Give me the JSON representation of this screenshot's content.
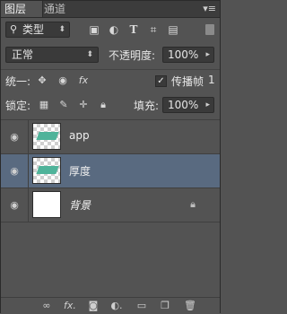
{
  "tabs": [
    {
      "label": "图层"
    },
    {
      "label": "通道"
    }
  ],
  "menu_icon": "panel-menu-icon",
  "filter": {
    "kind_label": "类型",
    "icons": [
      "image-filter-icon",
      "adjustment-filter-icon",
      "type-filter-icon",
      "shape-filter-icon",
      "smart-object-filter-icon"
    ]
  },
  "blend": {
    "mode": "正常",
    "opacity_label": "不透明度:",
    "opacity_value": "100%"
  },
  "unify": {
    "label": "统一:",
    "propagate_label": "传播帧",
    "propagate_checked": true,
    "frame_number": "1"
  },
  "lock": {
    "label": "锁定:",
    "fill_label": "填充:",
    "fill_value": "100%"
  },
  "layers": [
    {
      "name": "app",
      "visible": true,
      "selected": false,
      "thumbnail": "transparent-shape",
      "locked": false
    },
    {
      "name": "厚度",
      "visible": true,
      "selected": true,
      "thumbnail": "transparent-shape",
      "locked": false
    },
    {
      "name": "背景",
      "visible": true,
      "selected": false,
      "thumbnail": "white",
      "locked": true
    }
  ],
  "bottom_icons": [
    "link-layers-icon",
    "fx-icon",
    "add-mask-icon",
    "adjustment-layer-icon",
    "new-group-icon",
    "new-layer-icon",
    "delete-layer-icon"
  ]
}
